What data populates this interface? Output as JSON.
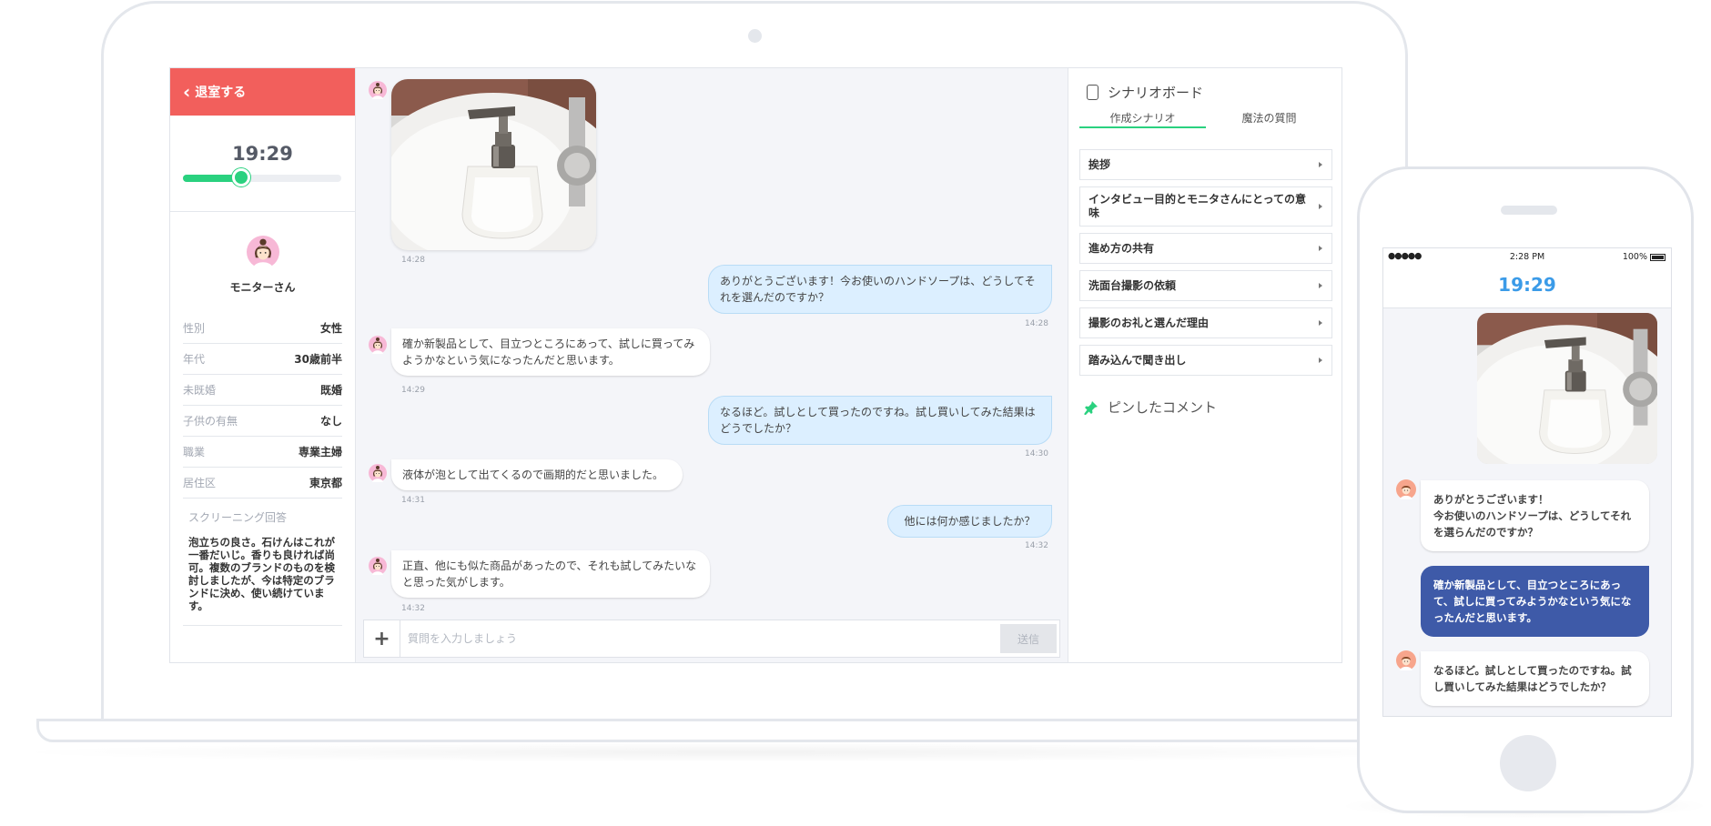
{
  "app": {
    "exit_label": "退室する",
    "timer": "19:29",
    "elapsed_fraction": 0.37
  },
  "monitor": {
    "name": "モニターさん",
    "attributes": [
      {
        "label": "性別",
        "value": "女性"
      },
      {
        "label": "年代",
        "value": "30歳前半"
      },
      {
        "label": "未既婚",
        "value": "既婚"
      },
      {
        "label": "子供の有無",
        "value": "なし"
      },
      {
        "label": "職業",
        "value": "専業主婦"
      },
      {
        "label": "居住区",
        "value": "東京都"
      }
    ],
    "screening_label": "スクリーニング回答",
    "screening_answer": "泡立ちの良さ。石けんはこれが一番だいじ。香りも良ければ尚可。複数のブランドのものを検討しましたが、今は特定のブランドに決め、使い続けています。"
  },
  "chat": {
    "messages": [
      {
        "time": "14:28"
      },
      {
        "text": "ありがとうございます！今お使いのハンドソープは、どうしてそれを選んだのですか？",
        "time": "14:28"
      },
      {
        "text": "確か新製品として、目立つところにあって、試しに買ってみようかなという気になったんだと思います。",
        "time": "14:29"
      },
      {
        "text": "なるほど。試しとして買ったのですね。試し買いしてみた結果はどうでしたか？",
        "time": "14:30"
      },
      {
        "text": "液体が泡として出てくるので画期的だと思いました。",
        "time": "14:31"
      },
      {
        "text": "他には何か感じましたか？",
        "time": "14:32"
      },
      {
        "text": "正直、他にも似た商品があったので、それも試してみたいなと思った気がします。",
        "time": "14:32"
      }
    ],
    "input_placeholder": "質問を入力しましょう",
    "send_label": "送信"
  },
  "scenario": {
    "title": "シナリオボード",
    "tabs": [
      "作成シナリオ",
      "魔法の質問"
    ],
    "items": [
      "挨拶",
      "インタビュー目的とモニタさんにとっての意味",
      "進め方の共有",
      "洗面台撮影の依頼",
      "撮影のお礼と選んだ理由",
      "踏み込んで聞き出し"
    ],
    "pinned_label": "ピンしたコメント"
  },
  "phone": {
    "signal": "●●●●● ",
    "clock": "2:28 PM",
    "battery": "100%",
    "timer": "19:29",
    "messages": [
      {
        "text": "ありがとうございます！\n今お使いのハンドソープは、どうしてそれを選らんだのですか？"
      },
      {
        "text": "確か新製品として、目立つところにあって、試しに買ってみようかなという気になったんだと思います。"
      },
      {
        "text": "なるほど。試しとして買ったのですね。試し買いしてみた結果はどうでしたか？"
      }
    ]
  },
  "colors": {
    "exit_red": "#f25f5c",
    "accent_green": "#2ad17f",
    "phone_timer_blue": "#3b9be8",
    "phone_bubble_blue": "#3e5aa8",
    "question_bubble": "#dcefff"
  }
}
